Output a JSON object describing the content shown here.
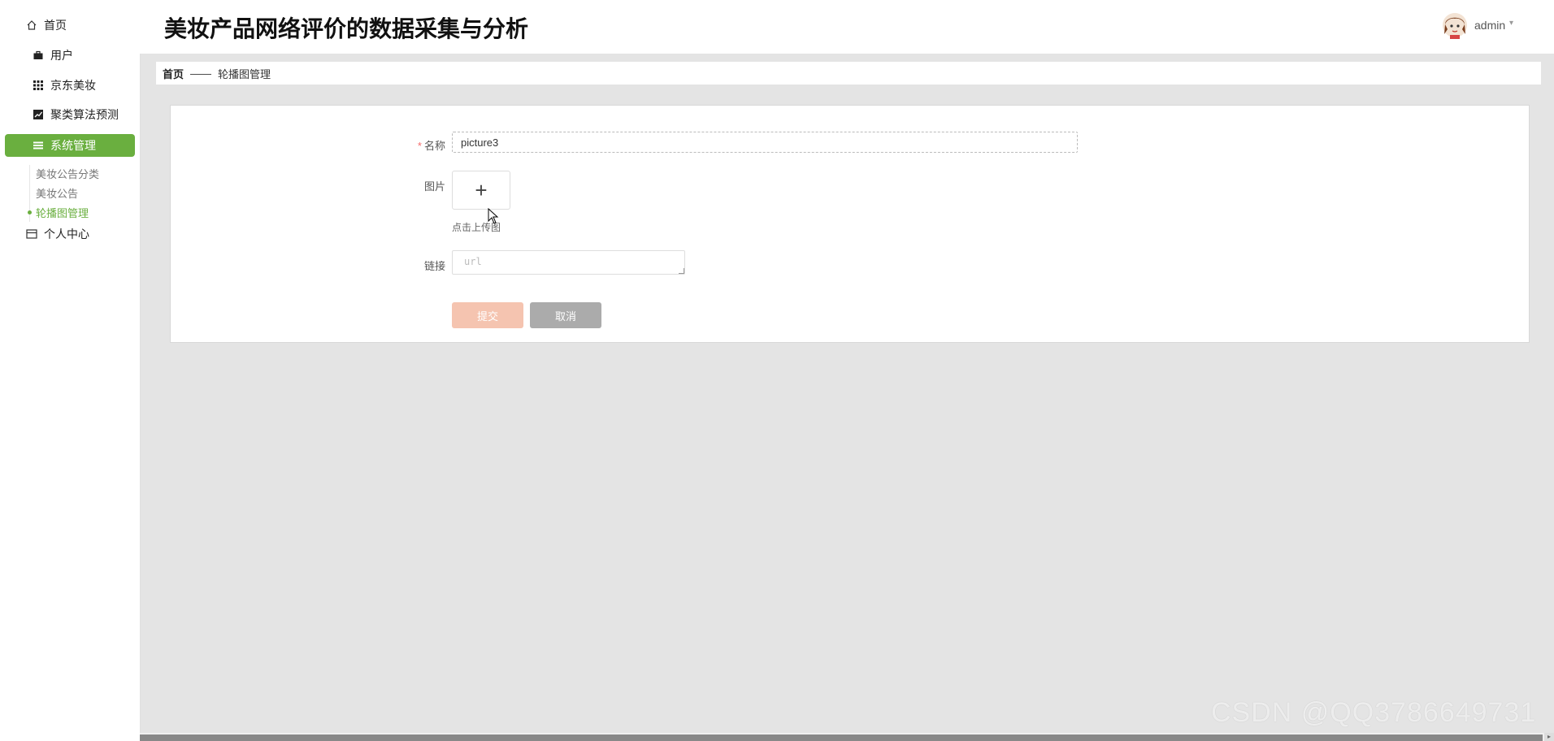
{
  "app": {
    "title": "美妆产品网络评价的数据采集与分析"
  },
  "user": {
    "name": "admin",
    "caret": "▾"
  },
  "sidebar": {
    "items": [
      {
        "label": "首页",
        "icon": "home-icon"
      },
      {
        "label": "用户",
        "icon": "briefcase-icon"
      },
      {
        "label": "京东美妆",
        "icon": "grid-icon"
      },
      {
        "label": "聚类算法预测",
        "icon": "chart-icon"
      },
      {
        "label": "系统管理",
        "icon": "list-icon",
        "active": true
      },
      {
        "label": "个人中心",
        "icon": "card-icon"
      }
    ],
    "sub_items": [
      {
        "label": "美妆公告分类"
      },
      {
        "label": "美妆公告"
      },
      {
        "label": "轮播图管理",
        "active": true
      }
    ]
  },
  "breadcrumb": {
    "home": "首页",
    "separator": "——",
    "current": "轮播图管理"
  },
  "form": {
    "name_label": "名称",
    "required_mark": "*",
    "name_value": "picture3",
    "image_label": "图片",
    "upload_plus": "+",
    "upload_hint": "点击上传图",
    "link_label": "链接",
    "link_placeholder": "url",
    "submit_label": "提交",
    "cancel_label": "取消"
  },
  "watermark": "CSDN @QQ3786649731",
  "colors": {
    "accent": "#6aaf3f",
    "submit": "#f5c4b0",
    "cancel": "#ababab",
    "background": "#e4e4e4"
  }
}
